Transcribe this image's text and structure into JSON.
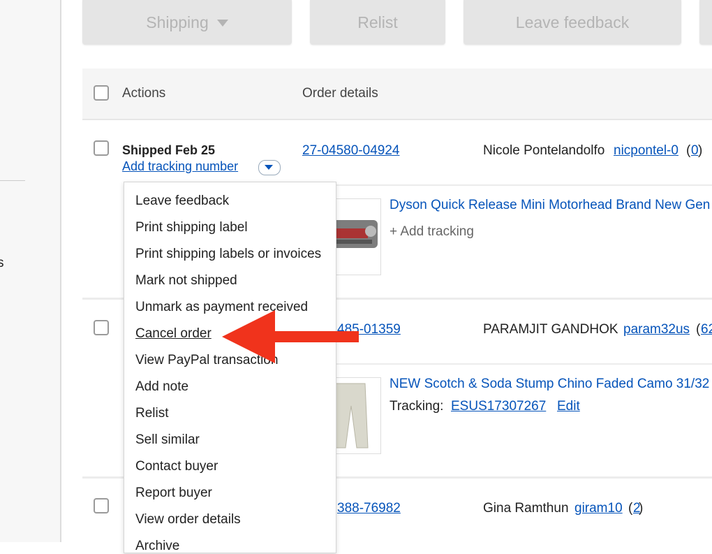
{
  "toolbar": {
    "shipping_label": "Shipping",
    "relist_label": "Relist",
    "leave_feedback_label": "Leave feedback"
  },
  "table_header": {
    "actions": "Actions",
    "order_details": "Order details"
  },
  "orders": [
    {
      "status": "Shipped Feb 25",
      "add_tracking": "Add tracking number",
      "order_number": "27-04580-04924",
      "buyer_name": "Nicole Pontelandolfo",
      "buyer_id": "nicpontel-0",
      "feedback_open": "(",
      "feedback_count": "0",
      "feedback_close": ")",
      "item_title": "Dyson Quick Release Mini Motorhead Brand New Gen",
      "add_tracking_item": "+ Add tracking"
    },
    {
      "order_number": "485-01359",
      "buyer_name": "PARAMJIT GANDHOK",
      "buyer_id": "param32us",
      "feedback_open": "(",
      "feedback_count": "62",
      "item_title": "NEW Scotch & Soda Stump Chino Faded Camo 31/32",
      "tracking_label": "Tracking:",
      "tracking_number": "ESUS17307267",
      "edit_label": "Edit"
    },
    {
      "order_number": "388-76982",
      "buyer_name": "Gina Ramthun",
      "buyer_id": "giram10",
      "feedback_open": "(",
      "feedback_count": "2",
      "feedback_close": ")"
    }
  ],
  "left_rail": {
    "fragment": "s"
  },
  "menu": {
    "items": [
      "Leave feedback",
      "Print shipping label",
      "Print shipping labels or invoices",
      "Mark not shipped",
      "Unmark as payment received",
      "Cancel order",
      "View PayPal transaction",
      "Add note",
      "Relist",
      "Sell similar",
      "Contact buyer",
      "Report buyer",
      "View order details",
      "Archive"
    ],
    "highlighted_index": 5
  },
  "colors": {
    "link": "#0654ba",
    "arrow": "#f0331c"
  },
  "icons": [
    "chevron-down-icon",
    "plus-icon",
    "red-arrow-icon"
  ]
}
